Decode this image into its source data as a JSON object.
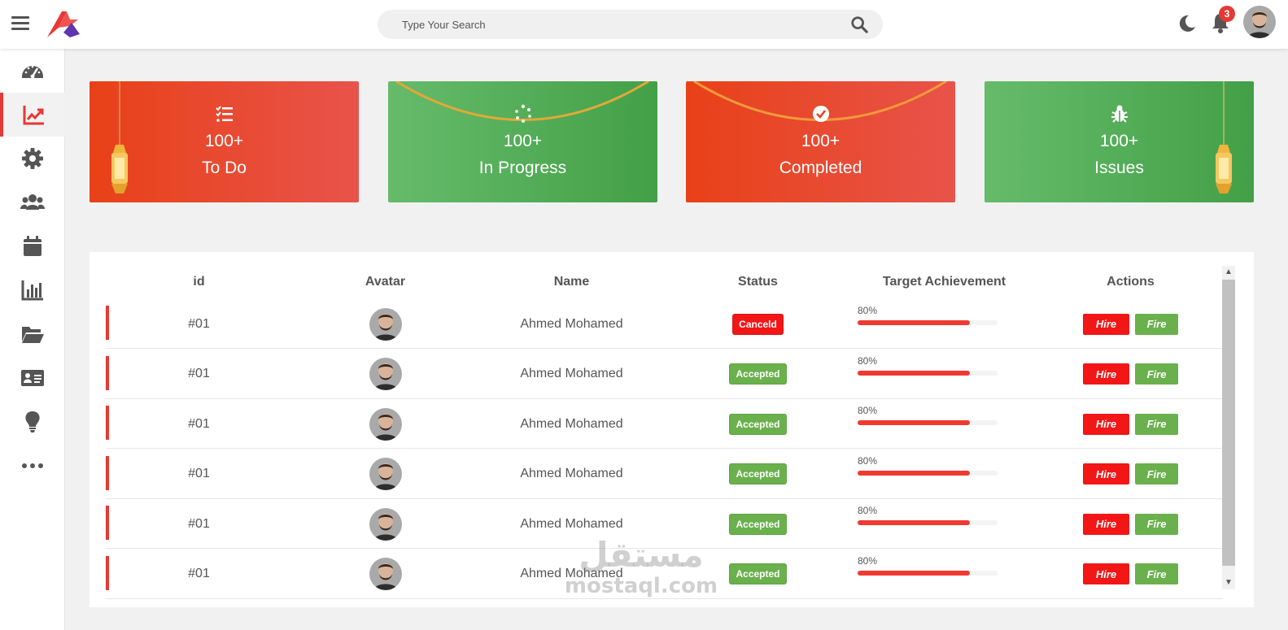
{
  "header": {
    "search_placeholder": "Type Your Search",
    "notification_count": "3"
  },
  "sidebar": {
    "items": [
      {
        "icon": "dashboard-icon",
        "active": false
      },
      {
        "icon": "chart-line-icon",
        "active": true
      },
      {
        "icon": "gear-icon",
        "active": false
      },
      {
        "icon": "users-icon",
        "active": false
      },
      {
        "icon": "calendar-icon",
        "active": false
      },
      {
        "icon": "bar-chart-icon",
        "active": false
      },
      {
        "icon": "folder-open-icon",
        "active": false
      },
      {
        "icon": "id-card-icon",
        "active": false
      },
      {
        "icon": "lightbulb-icon",
        "active": false
      },
      {
        "icon": "more-icon",
        "active": false
      }
    ]
  },
  "cards": [
    {
      "value": "100+",
      "label": "To Do",
      "icon": "list-check-icon",
      "color": "#e84118"
    },
    {
      "value": "100+",
      "label": "In Progress",
      "icon": "spinner-icon",
      "color": "#4caf50"
    },
    {
      "value": "100+",
      "label": "Completed",
      "icon": "check-circle-icon",
      "color": "#e84118"
    },
    {
      "value": "100+",
      "label": "Issues",
      "icon": "bug-icon",
      "color": "#4caf50"
    }
  ],
  "table": {
    "headers": [
      "id",
      "Avatar",
      "Name",
      "Status",
      "Target Achievement",
      "Actions"
    ],
    "rows": [
      {
        "id": "#01",
        "name": "Ahmed Mohamed",
        "status": "Canceld",
        "status_type": "cancel",
        "target": "80%",
        "target_value": 0.8,
        "hire": "Hire",
        "fire": "Fire"
      },
      {
        "id": "#01",
        "name": "Ahmed Mohamed",
        "status": "Accepted",
        "status_type": "accept",
        "target": "80%",
        "target_value": 0.8,
        "hire": "Hire",
        "fire": "Fire"
      },
      {
        "id": "#01",
        "name": "Ahmed Mohamed",
        "status": "Accepted",
        "status_type": "accept",
        "target": "80%",
        "target_value": 0.8,
        "hire": "Hire",
        "fire": "Fire"
      },
      {
        "id": "#01",
        "name": "Ahmed Mohamed",
        "status": "Accepted",
        "status_type": "accept",
        "target": "80%",
        "target_value": 0.8,
        "hire": "Hire",
        "fire": "Fire"
      },
      {
        "id": "#01",
        "name": "Ahmed Mohamed",
        "status": "Accepted",
        "status_type": "accept",
        "target": "80%",
        "target_value": 0.8,
        "hire": "Hire",
        "fire": "Fire"
      },
      {
        "id": "#01",
        "name": "Ahmed Mohamed",
        "status": "Accepted",
        "status_type": "accept",
        "target": "80%",
        "target_value": 0.8,
        "hire": "Hire",
        "fire": "Fire"
      }
    ]
  },
  "watermark": {
    "arabic": "مستقل",
    "latin": "mostaql.com"
  },
  "colors": {
    "accent_red": "#e53935",
    "accent_green": "#4caf50"
  }
}
